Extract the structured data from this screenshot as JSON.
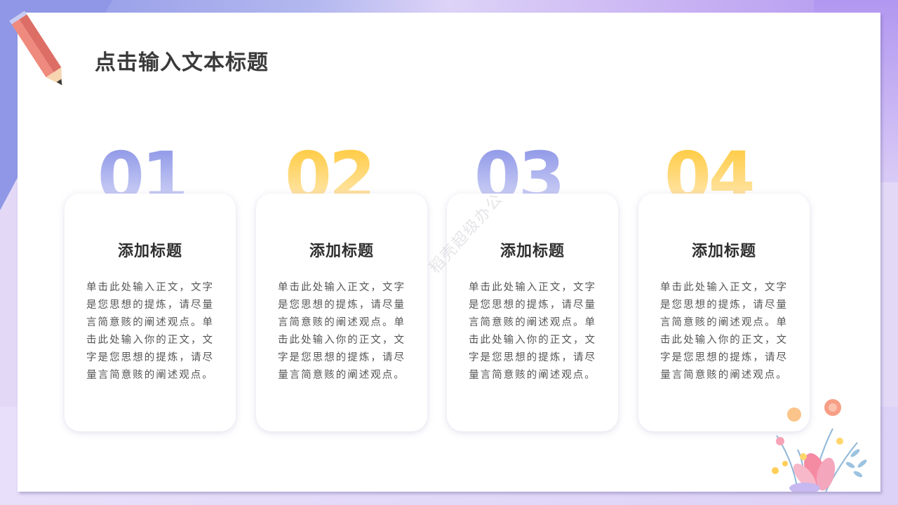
{
  "title": "点击输入文本标题",
  "watermark": "稻壳超级办公",
  "cards": [
    {
      "number": "01",
      "title": "添加标题",
      "body": "单击此处输入正文，文字是您思想的提炼，请尽量言简意赅的阐述观点。单击此处输入你的正文，文字是您思想的提炼，请尽量言简意赅的阐述观点。"
    },
    {
      "number": "02",
      "title": "添加标题",
      "body": "单击此处输入正文，文字是您思想的提炼，请尽量言简意赅的阐述观点。单击此处输入你的正文，文字是您思想的提炼，请尽量言简意赅的阐述观点。"
    },
    {
      "number": "03",
      "title": "添加标题",
      "body": "单击此处输入正文，文字是您思想的提炼，请尽量言简意赅的阐述观点。单击此处输入你的正文，文字是您思想的提炼，请尽量言简意赅的阐述观点。"
    },
    {
      "number": "04",
      "title": "添加标题",
      "body": "单击此处输入正文，文字是您思想的提炼，请尽量言简意赅的阐述观点。单击此处输入你的正文，文字是您思想的提炼，请尽量言简意赅的阐述观点。"
    }
  ],
  "colors": {
    "blue": "#8a93e6",
    "yellow": "#ffc93a",
    "bg_purple": "#b297f0"
  },
  "icons": [
    "pencil-icon",
    "flower-decoration"
  ]
}
